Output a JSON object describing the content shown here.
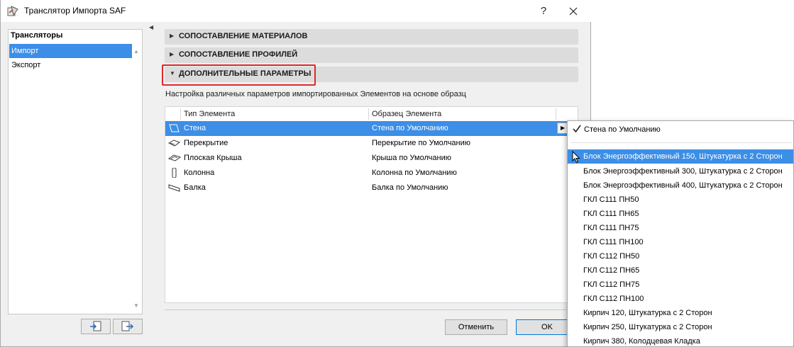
{
  "window": {
    "title": "Транслятор Импорта SAF",
    "help_label": "?"
  },
  "left_panel": {
    "header": "Трансляторы",
    "items": [
      {
        "label": "Импорт",
        "selected": true
      },
      {
        "label": "Экспорт",
        "selected": false
      }
    ]
  },
  "sections": [
    {
      "label": "СОПОСТАВЛЕНИЕ МАТЕРИАЛОВ",
      "expanded": false
    },
    {
      "label": "СОПОСТАВЛЕНИЕ ПРОФИЛЕЙ",
      "expanded": false
    },
    {
      "label": "ДОПОЛНИТЕЛЬНЫЕ ПАРАМЕТРЫ",
      "expanded": true
    }
  ],
  "description": "Настройка различных параметров импортированных Элементов на основе образц",
  "table": {
    "columns": [
      "Тип Элемента",
      "Образец Элемента"
    ],
    "rows": [
      {
        "type": "Стена",
        "sample": "Стена по Умолчанию",
        "icon": "wall-icon",
        "selected": true
      },
      {
        "type": "Перекрытие",
        "sample": "Перекрытие по Умолчанию",
        "icon": "slab-icon",
        "selected": false
      },
      {
        "type": "Плоская Крыша",
        "sample": "Крыша по Умолчанию",
        "icon": "flat-roof-icon",
        "selected": false
      },
      {
        "type": "Колонна",
        "sample": "Колонна по Умолчанию",
        "icon": "column-icon",
        "selected": false
      },
      {
        "type": "Балка",
        "sample": "Балка по Умолчанию",
        "icon": "beam-icon",
        "selected": false
      }
    ]
  },
  "buttons": {
    "cancel": "Отменить",
    "ok": "OK"
  },
  "dropdown": {
    "current": "Стена по Умолчанию",
    "items": [
      {
        "label": "Блок Энергоэффективный 150, Штукатурка с 2 Сторон",
        "hover": true
      },
      {
        "label": "Блок Энергоэффективный 300, Штукатурка с 2 Сторон",
        "hover": false
      },
      {
        "label": "Блок Энергоэффективный 400, Штукатурка с 2 Сторон",
        "hover": false
      },
      {
        "label": "ГКЛ С111 ПН50",
        "hover": false
      },
      {
        "label": "ГКЛ С111 ПН65",
        "hover": false
      },
      {
        "label": "ГКЛ С111 ПН75",
        "hover": false
      },
      {
        "label": "ГКЛ С111 ПН100",
        "hover": false
      },
      {
        "label": "ГКЛ С112 ПН50",
        "hover": false
      },
      {
        "label": "ГКЛ С112 ПН65",
        "hover": false
      },
      {
        "label": "ГКЛ С112 ПН75",
        "hover": false
      },
      {
        "label": "ГКЛ С112 ПН100",
        "hover": false
      },
      {
        "label": "Кирпич 120, Штукатурка с 2 Сторон",
        "hover": false
      },
      {
        "label": "Кирпич 250, Штукатурка с 2 Сторон",
        "hover": false
      },
      {
        "label": "Кирпич 380, Колодцевая Кладка",
        "hover": false
      }
    ]
  },
  "colors": {
    "selection": "#3c8ee6",
    "highlight_box": "#e0282a",
    "section_bar": "#dcdcdc"
  }
}
